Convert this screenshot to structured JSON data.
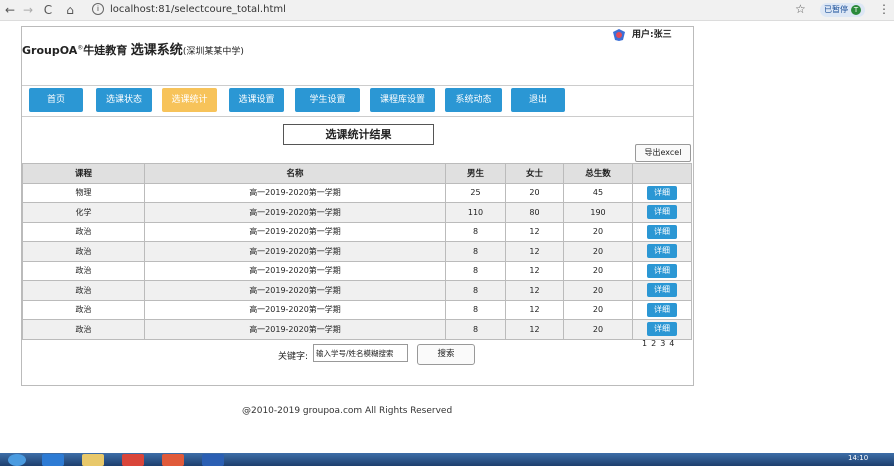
{
  "browser": {
    "url": "localhost:81/selectcoure_total.html",
    "paused_label": "已暂停",
    "profile_initial": "T"
  },
  "header": {
    "brand": "GroupOA",
    "brand_sup": "®",
    "brand_cn": "牛娃教育",
    "system_title": "选课系统",
    "school": "(深圳某某中学)",
    "user_label": "用户:张三"
  },
  "nav": {
    "items": [
      {
        "label": "首页"
      },
      {
        "label": "选课状态"
      },
      {
        "label": "选课统计"
      },
      {
        "label": "选课设置"
      },
      {
        "label": "学生设置"
      },
      {
        "label": "课程库设置"
      },
      {
        "label": "系统动态"
      },
      {
        "label": "退出"
      }
    ],
    "active_index": 2
  },
  "main": {
    "title": "选课统计结果",
    "export_label": "导出excel",
    "columns": [
      "课程",
      "名称",
      "男生",
      "女士",
      "总生数",
      ""
    ],
    "detail_label": "详细",
    "rows": [
      {
        "course": "物理",
        "name": "高一2019-2020第一学期",
        "male": "25",
        "female": "20",
        "total": "45"
      },
      {
        "course": "化学",
        "name": "高一2019-2020第一学期",
        "male": "110",
        "female": "80",
        "total": "190"
      },
      {
        "course": "政治",
        "name": "高一2019-2020第一学期",
        "male": "8",
        "female": "12",
        "total": "20"
      },
      {
        "course": "政治",
        "name": "高一2019-2020第一学期",
        "male": "8",
        "female": "12",
        "total": "20"
      },
      {
        "course": "政治",
        "name": "高一2019-2020第一学期",
        "male": "8",
        "female": "12",
        "total": "20"
      },
      {
        "course": "政治",
        "name": "高一2019-2020第一学期",
        "male": "8",
        "female": "12",
        "total": "20"
      },
      {
        "course": "政治",
        "name": "高一2019-2020第一学期",
        "male": "8",
        "female": "12",
        "total": "20"
      },
      {
        "course": "政治",
        "name": "高一2019-2020第一学期",
        "male": "8",
        "female": "12",
        "total": "20"
      }
    ],
    "pages": [
      "1",
      "2",
      "3",
      "4"
    ],
    "search_label": "关键字:",
    "search_value": "输入学号/姓名模糊搜索",
    "search_button": "搜索"
  },
  "footer": {
    "copyright": "@2010-2019 groupoa.com  All Rights Reserved"
  },
  "taskbar": {
    "time": "14:10"
  },
  "colors": {
    "accent": "#2b97d4",
    "active": "#f7c35a"
  }
}
